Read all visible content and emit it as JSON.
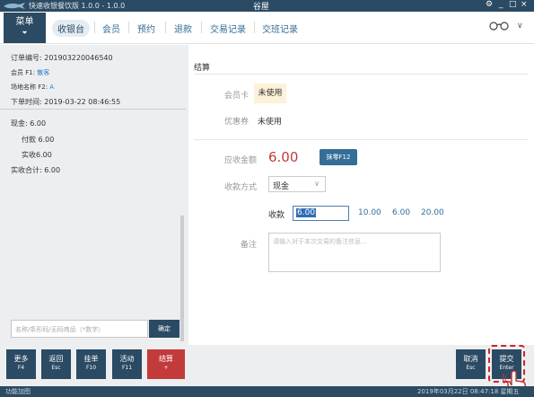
{
  "title_bar": {
    "app_name": "快速收银餐饮版 1.0.0 - 1.0.0",
    "center": "谷屋",
    "controls": [
      "⚙",
      "_",
      "□",
      "×"
    ]
  },
  "menu": {
    "label": "菜单",
    "chevron": "⏷"
  },
  "nav_tabs": [
    {
      "label": "收银台",
      "active": true
    },
    {
      "label": "会员"
    },
    {
      "label": "预约"
    },
    {
      "label": "退款"
    },
    {
      "label": "交易记录"
    },
    {
      "label": "交班记录"
    }
  ],
  "chevron_down": "∨",
  "order": {
    "number_label": "订单编号: ",
    "number": "201903220046540",
    "member_label": "会员",
    "member_key": " F1: ",
    "member_value": "散客",
    "site_label": "场地名称",
    "site_key": " F2: ",
    "site_value": "A",
    "time_label": "下单时间: ",
    "time": "2019-03-22 08:46:55"
  },
  "payment_summary": {
    "cash": "现金: 6.00",
    "paid": "付款 6.00",
    "actual": "实收6.00",
    "total": "实收合计: 6.00"
  },
  "search": {
    "placeholder": "名称/条形码/无码商品（*数字）",
    "confirm": "确定"
  },
  "function_buttons": [
    {
      "label": "更多",
      "key": "F4"
    },
    {
      "label": "返回",
      "key": "Esc"
    },
    {
      "label": "挂单",
      "key": "F10"
    },
    {
      "label": "活动",
      "key": "F11"
    },
    {
      "label": "结算",
      "key": "+"
    }
  ],
  "status_left": "功能加图",
  "status_right": "2019年03月22日 08:47:18 星期五",
  "checkout": {
    "title": "结算",
    "member_card_label": "会员卡",
    "member_card_value": "未使用",
    "coupon_label": "优惠券",
    "coupon_value": "未使用",
    "receivable_label": "应收金额",
    "receivable": "6.00",
    "round_btn": "抹零F12",
    "pay_method_label": "收款方式",
    "pay_method": "现金",
    "pay_method_arrow": "∨",
    "received_label": "收款",
    "received_value": "6.00",
    "quick_amounts": [
      "10.00",
      "6.00",
      "20.00"
    ],
    "remark_label": "备注",
    "remark_placeholder": "请输入对于本次交易的备注信息..."
  },
  "actions": {
    "cancel": "取消",
    "cancel_key": "Esc",
    "submit": "提交",
    "submit_key": "Enter"
  },
  "colors": {
    "primary": "#2b4a63",
    "accent_red": "#c33a3a",
    "link": "#336e96"
  }
}
